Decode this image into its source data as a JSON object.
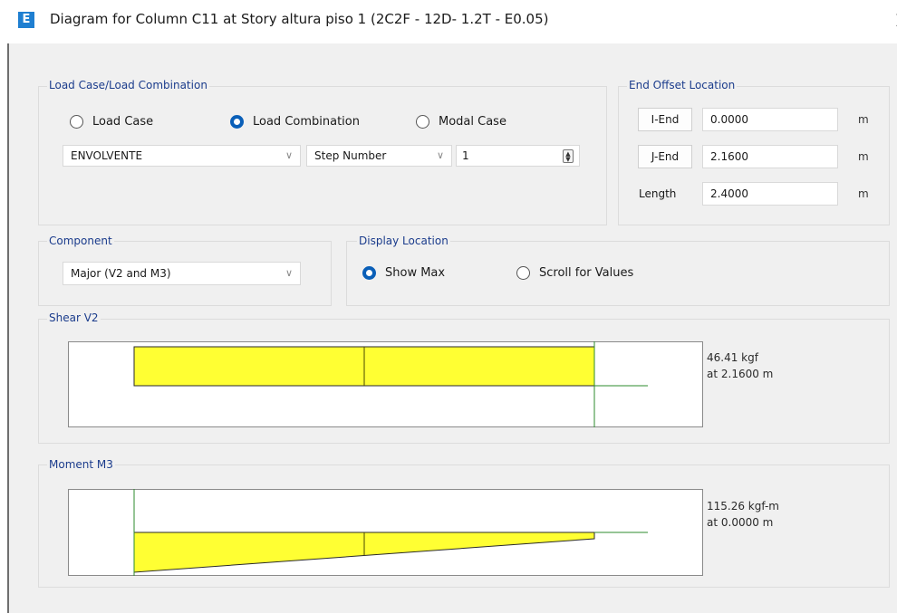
{
  "window": {
    "app_icon_letter": "E",
    "title": "Diagram for Column C11 at Story altura piso 1 (2C2F - 12D- 1.2T - E0.05)",
    "close_glyph": ")"
  },
  "load_case_group": {
    "label": "Load Case/Load Combination",
    "radios": [
      {
        "label": "Load Case",
        "selected": false
      },
      {
        "label": "Load Combination",
        "selected": true
      },
      {
        "label": "Modal Case",
        "selected": false
      }
    ],
    "case_combo": {
      "value": "ENVOLVENTE"
    },
    "step_combo": {
      "value": "Step Number"
    },
    "step_spinner": {
      "value": "1"
    }
  },
  "end_offset_group": {
    "label": "End Offset Location",
    "rows": [
      {
        "label": "I-End",
        "value": "0.0000",
        "unit": "m"
      },
      {
        "label": "J-End",
        "value": "2.1600",
        "unit": "m"
      },
      {
        "label": "Length",
        "value": "2.4000",
        "unit": "m"
      }
    ]
  },
  "component_group": {
    "label": "Component",
    "combo": {
      "value": "Major (V2 and M3)"
    }
  },
  "display_location_group": {
    "label": "Display Location",
    "radios": [
      {
        "label": "Show Max",
        "selected": true
      },
      {
        "label": "Scroll for Values",
        "selected": false
      }
    ]
  },
  "shear_group": {
    "label": "Shear V2",
    "value_line1": "46.41 kgf",
    "value_line2": "at 2.1600 m"
  },
  "moment_group": {
    "label": "Moment M3",
    "value_line1": "115.26 kgf-m",
    "value_line2": "at 0.0000 m"
  },
  "colors": {
    "diagram_fill": "#ffff33",
    "diagram_outline": "#2a2a2a",
    "station_line": "#2e8b2e",
    "group_label": "#1b3c8c",
    "selected_radio": "#0a5fb8"
  }
}
